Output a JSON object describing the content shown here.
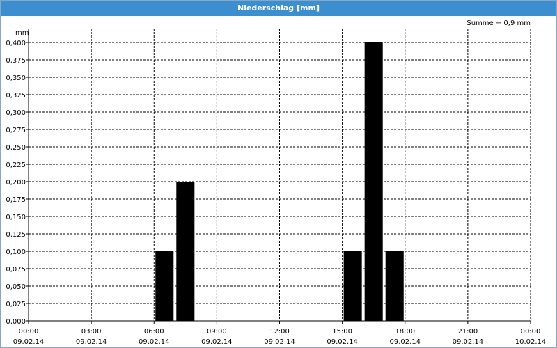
{
  "window": {
    "title": "Niederschlag [mm]"
  },
  "chart_data": {
    "type": "bar",
    "ylabel": "mm",
    "annotation": "Summe = 0,9 mm",
    "ylim": [
      0,
      0.4
    ],
    "yticks": [
      "0,000",
      "0,025",
      "0,050",
      "0,075",
      "0,100",
      "0,125",
      "0,150",
      "0,175",
      "0,200",
      "0,225",
      "0,250",
      "0,275",
      "0,300",
      "0,325",
      "0,350",
      "0,375",
      "0,400"
    ],
    "xlim_hours": [
      0,
      24
    ],
    "xticks": [
      {
        "time": "00:00",
        "date": "09.02.14"
      },
      {
        "time": "03:00",
        "date": "09.02.14"
      },
      {
        "time": "06:00",
        "date": "09.02.14"
      },
      {
        "time": "09:00",
        "date": "09.02.14"
      },
      {
        "time": "12:00",
        "date": "09.02.14"
      },
      {
        "time": "15:00",
        "date": "09.02.14"
      },
      {
        "time": "18:00",
        "date": "09.02.14"
      },
      {
        "time": "21:00",
        "date": "09.02.14"
      },
      {
        "time": "00:00",
        "date": "10.02.14"
      }
    ],
    "bars": [
      {
        "start": "06:00",
        "end": "07:00",
        "value": 0.1
      },
      {
        "start": "07:00",
        "end": "08:00",
        "value": 0.2
      },
      {
        "start": "15:00",
        "end": "16:00",
        "value": 0.1
      },
      {
        "start": "16:00",
        "end": "17:00",
        "value": 0.4
      },
      {
        "start": "17:00",
        "end": "18:00",
        "value": 0.1
      }
    ],
    "grid": true
  }
}
